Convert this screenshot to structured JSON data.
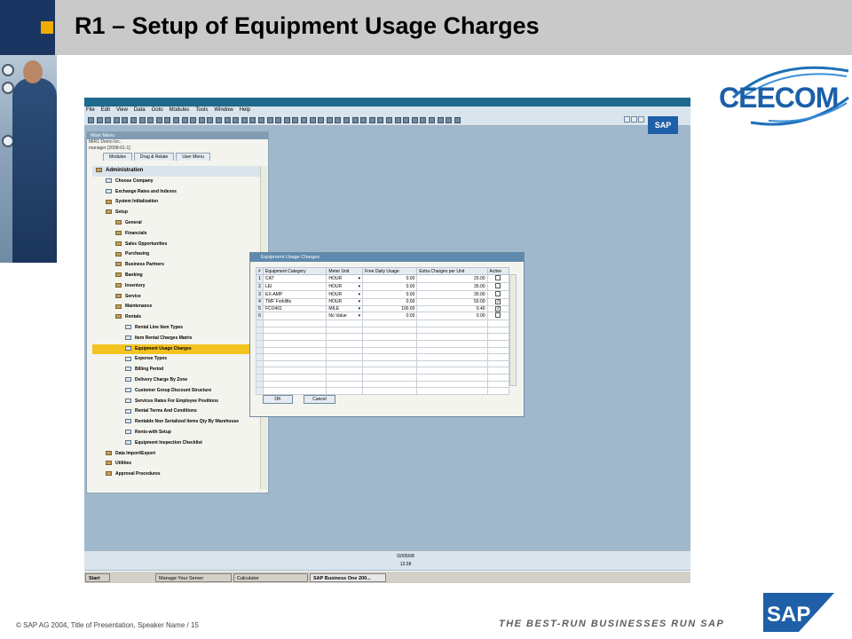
{
  "slide": {
    "title": "R1 – Setup of Equipment Usage Charges",
    "brand_logo": "CEECOM",
    "footer": "©  SAP AG 2004, Title of Presentation, Speaker Name / 15",
    "tagline": "THE BEST-RUN BUSINESSES RUN SAP",
    "sap_logo": "SAP",
    "colors": {
      "header_navy": "#1b3563",
      "header_bar": "#c9c9c9",
      "accent_square": "#f0ab00",
      "desktop_bg": "#a0b8cc"
    }
  },
  "app": {
    "menu": [
      "File",
      "Edit",
      "View",
      "Data",
      "Goto",
      "Modules",
      "Tools",
      "Window",
      "Help"
    ],
    "sap_logo": "SAP"
  },
  "main_menu": {
    "title": "Main Menu",
    "company": "MIR1 Demo Inc.",
    "user": "manager [2008-01-1]",
    "tabs": [
      "Modules",
      "Drag & Relate",
      "User Menu"
    ],
    "tree": [
      {
        "label": "Administration",
        "level": 0,
        "icon": "module"
      },
      {
        "label": "Choose Company",
        "level": 1,
        "icon": "doc"
      },
      {
        "label": "Exchange Rates and Indexes",
        "level": 1,
        "icon": "doc"
      },
      {
        "label": "System Initialization",
        "level": 1,
        "icon": "folder"
      },
      {
        "label": "Setup",
        "level": 1,
        "icon": "folder-open"
      },
      {
        "label": "General",
        "level": 2,
        "icon": "folder"
      },
      {
        "label": "Financials",
        "level": 2,
        "icon": "folder"
      },
      {
        "label": "Sales Opportunities",
        "level": 2,
        "icon": "folder"
      },
      {
        "label": "Purchasing",
        "level": 2,
        "icon": "folder"
      },
      {
        "label": "Business Partners",
        "level": 2,
        "icon": "folder"
      },
      {
        "label": "Banking",
        "level": 2,
        "icon": "folder"
      },
      {
        "label": "Inventory",
        "level": 2,
        "icon": "folder"
      },
      {
        "label": "Service",
        "level": 2,
        "icon": "folder"
      },
      {
        "label": "Maintenance",
        "level": 2,
        "icon": "folder"
      },
      {
        "label": "Rentals",
        "level": 2,
        "icon": "folder-open"
      },
      {
        "label": "Rental Line Item Types",
        "level": 3,
        "icon": "doc"
      },
      {
        "label": "Item Rental Charges Matrix",
        "level": 3,
        "icon": "doc"
      },
      {
        "label": "Equipment Usage Charges",
        "level": 3,
        "icon": "doc",
        "selected": true
      },
      {
        "label": "Expense Types",
        "level": 3,
        "icon": "doc"
      },
      {
        "label": "Billing Period",
        "level": 3,
        "icon": "doc"
      },
      {
        "label": "Delivery Charge By Zone",
        "level": 3,
        "icon": "doc"
      },
      {
        "label": "Customer Group Discount Structure",
        "level": 3,
        "icon": "doc"
      },
      {
        "label": "Services Rates For Employee Positions",
        "level": 3,
        "icon": "doc"
      },
      {
        "label": "Rental Terms And Conditions",
        "level": 3,
        "icon": "doc"
      },
      {
        "label": "Rentable Non Serialized Items Qty By Warehouse",
        "level": 3,
        "icon": "doc"
      },
      {
        "label": "Rents-with Setup",
        "level": 3,
        "icon": "doc"
      },
      {
        "label": "Equipment Inspection Checklist",
        "level": 3,
        "icon": "doc"
      },
      {
        "label": "Data Import/Export",
        "level": 1,
        "icon": "folder"
      },
      {
        "label": "Utilities",
        "level": 1,
        "icon": "folder"
      },
      {
        "label": "Approval Procedures",
        "level": 1,
        "icon": "folder"
      }
    ]
  },
  "equipment_window": {
    "title": "Equipment Usage Charges",
    "columns": [
      "#",
      "Equipment Category",
      "Meter Unit",
      "Free Daily Usage",
      "Extra Charges per Unit",
      "Active"
    ],
    "rows": [
      {
        "n": "1",
        "category": "CAT",
        "unit": "HOUR",
        "free": "0.00",
        "extra": "20.00",
        "active": false
      },
      {
        "n": "2",
        "category": "LEI",
        "unit": "HOUR",
        "free": "0.00",
        "extra": "30.00",
        "active": false
      },
      {
        "n": "3",
        "category": "EX-AMP",
        "unit": "HOUR",
        "free": "0.00",
        "extra": "30.00",
        "active": false
      },
      {
        "n": "4",
        "category": "TMF Forklifts",
        "unit": "HOUR",
        "free": "0.00",
        "extra": "50.00",
        "active": true
      },
      {
        "n": "5",
        "category": "FCO401",
        "unit": "MILE",
        "free": "100.00",
        "extra": "0.40",
        "active": true
      },
      {
        "n": "6",
        "category": "",
        "unit": "No Value",
        "free": "0.00",
        "extra": "0.00",
        "active": false
      }
    ],
    "empty_rows": 11,
    "ok_label": "OK",
    "cancel_label": "Cancel"
  },
  "status": {
    "date": "02/05/08",
    "time": "12:28"
  },
  "taskbar": {
    "start": "Start",
    "items": [
      "Manage Your Server",
      "Calculator",
      "SAP Business One 200..."
    ]
  }
}
